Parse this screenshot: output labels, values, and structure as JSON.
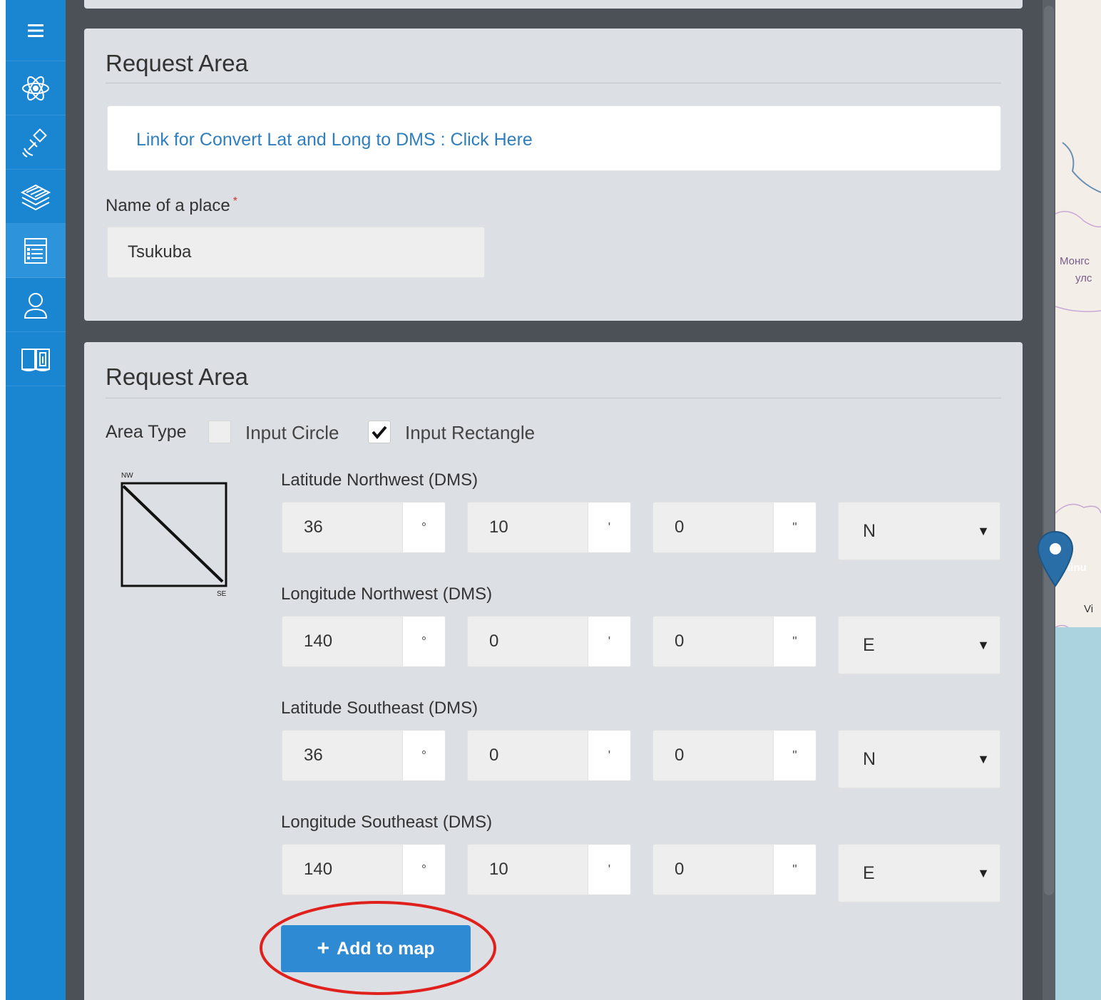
{
  "sidebar": {
    "items": [
      {
        "icon": "menu-icon"
      },
      {
        "icon": "atom-icon"
      },
      {
        "icon": "satellite-icon"
      },
      {
        "icon": "layers-icon"
      },
      {
        "icon": "list-icon",
        "active": true
      },
      {
        "icon": "user-icon"
      },
      {
        "icon": "manual-icon"
      }
    ]
  },
  "map": {
    "label_line1": "Монгс",
    "label_line2": "улс",
    "label_pin": "ninu",
    "label_pin2": "Vi",
    "sea_color": "#aad3df",
    "pin_color": "#2a6ea8"
  },
  "panel1": {
    "title": "Request Area",
    "link_text": "Link for Convert Lat and Long to DMS : Click Here",
    "place_label": "Name of a place",
    "required_mark": "*",
    "place_value": "Tsukuba"
  },
  "panel2": {
    "title": "Request Area",
    "area_type_label": "Area Type",
    "circle_label": "Input Circle",
    "circle_checked": false,
    "rect_label": "Input Rectangle",
    "rect_checked": true,
    "diagram": {
      "nw": "NW",
      "se": "SE"
    },
    "coords": [
      {
        "label": "Latitude Northwest (DMS)",
        "deg": "36",
        "min": "10",
        "sec": "0",
        "dir": "N"
      },
      {
        "label": "Longitude Northwest (DMS)",
        "deg": "140",
        "min": "0",
        "sec": "0",
        "dir": "E"
      },
      {
        "label": "Latitude Southeast (DMS)",
        "deg": "36",
        "min": "0",
        "sec": "0",
        "dir": "N"
      },
      {
        "label": "Longitude Southeast (DMS)",
        "deg": "140",
        "min": "10",
        "sec": "0",
        "dir": "E"
      }
    ],
    "units": {
      "deg": "°",
      "min": "'",
      "sec": "\""
    },
    "select_arrow": "▼",
    "add_button_icon": "+",
    "add_button_label": "Add to map"
  },
  "colors": {
    "sidebar": "#1a86d2",
    "button": "#2d8ad3",
    "link": "#2f7fbf",
    "highlight": "#e0201c"
  }
}
